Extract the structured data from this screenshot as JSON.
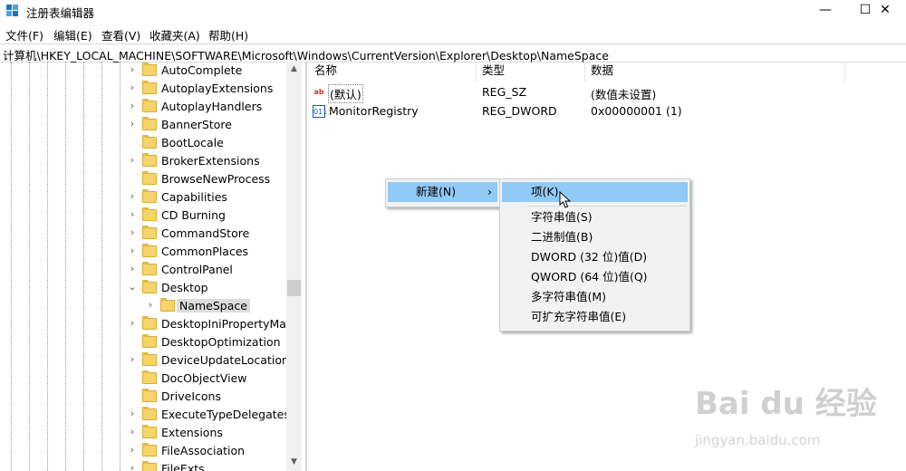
{
  "window": {
    "title": "注册表编辑器",
    "minimize": "—",
    "maximize": "☐",
    "close": "✕"
  },
  "menu": [
    "文件(F)",
    "编辑(E)",
    "查看(V)",
    "收藏夹(A)",
    "帮助(H)"
  ],
  "address": "计算机\\HKEY_LOCAL_MACHINE\\SOFTWARE\\Microsoft\\Windows\\CurrentVersion\\Explorer\\Desktop\\NameSpace",
  "tree": [
    {
      "label": "AutoComplete",
      "expander": ">"
    },
    {
      "label": "AutoplayExtensions",
      "expander": ">"
    },
    {
      "label": "AutoplayHandlers",
      "expander": ">"
    },
    {
      "label": "BannerStore",
      "expander": ">"
    },
    {
      "label": "BootLocale",
      "expander": ""
    },
    {
      "label": "BrokerExtensions",
      "expander": ">"
    },
    {
      "label": "BrowseNewProcess",
      "expander": ""
    },
    {
      "label": "Capabilities",
      "expander": ">"
    },
    {
      "label": "CD Burning",
      "expander": ">"
    },
    {
      "label": "CommandStore",
      "expander": ">"
    },
    {
      "label": "CommonPlaces",
      "expander": ">"
    },
    {
      "label": "ControlPanel",
      "expander": ">"
    },
    {
      "label": "Desktop",
      "expander": "v"
    },
    {
      "label": "NameSpace",
      "expander": ">",
      "selected": true,
      "child": true
    },
    {
      "label": "DesktopIniPropertyMap",
      "expander": ">"
    },
    {
      "label": "DesktopOptimization",
      "expander": ""
    },
    {
      "label": "DeviceUpdateLocations",
      "expander": ">"
    },
    {
      "label": "DocObjectView",
      "expander": ""
    },
    {
      "label": "DriveIcons",
      "expander": ""
    },
    {
      "label": "ExecuteTypeDelegates",
      "expander": ">"
    },
    {
      "label": "Extensions",
      "expander": ">"
    },
    {
      "label": "FileAssociation",
      "expander": ">"
    },
    {
      "label": "FileExts",
      "expander": ">"
    }
  ],
  "columns": {
    "name": "名称",
    "type": "类型",
    "data": "数据"
  },
  "values": [
    {
      "name": "(默认)",
      "type": "REG_SZ",
      "data": "(数值未设置)",
      "icon": "ab"
    },
    {
      "name": "MonitorRegistry",
      "type": "REG_DWORD",
      "data": "0x00000001 (1)",
      "icon": "011"
    }
  ],
  "context_menu": {
    "new": "新建(N)",
    "arrow": "›"
  },
  "submenu": [
    "项(K)",
    "字符串值(S)",
    "二进制值(B)",
    "DWORD (32 位)值(D)",
    "QWORD (64 位)值(Q)",
    "多字符串值(M)",
    "可扩充字符串值(E)"
  ],
  "watermark": {
    "logo": "Bai du 经验",
    "url": "jingyan.baidu.com"
  },
  "scroll": {
    "up": "▲",
    "down": "▼"
  }
}
